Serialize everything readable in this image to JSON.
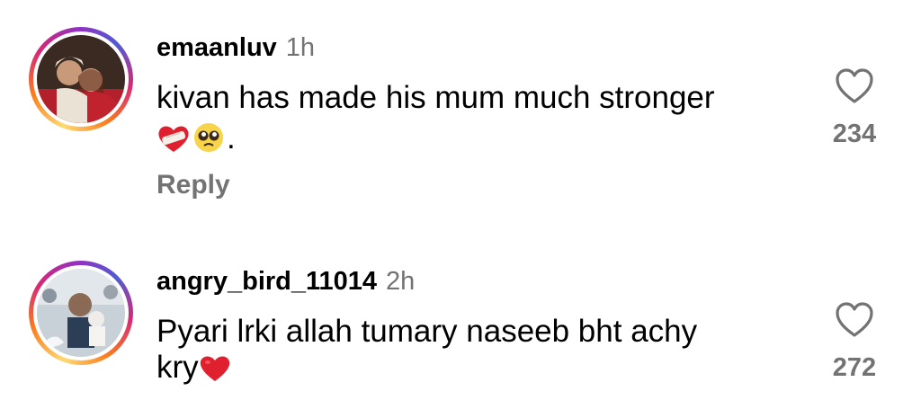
{
  "comments": [
    {
      "username": "emaanluv",
      "time": "1h",
      "text_line1": "kivan has made his mum much stronger",
      "text_line2_suffix": ".",
      "emojis": [
        "mending-heart-emoji",
        "pleading-face-emoji"
      ],
      "likes": "234",
      "reply_label": "Reply",
      "avatar_ring": "gradient",
      "icon": "heart-outline-icon"
    },
    {
      "username": "angry_bird_11014",
      "time": "2h",
      "text_line1": "Pyari lrki allah tumary naseeb bht achy",
      "text_line2": "kry",
      "emojis": [
        "red-heart-emoji"
      ],
      "likes": "272",
      "avatar_ring": "gradient",
      "icon": "heart-outline-icon"
    }
  ],
  "colors": {
    "meta_text": "#737373",
    "heart_red": "#e0202f"
  }
}
